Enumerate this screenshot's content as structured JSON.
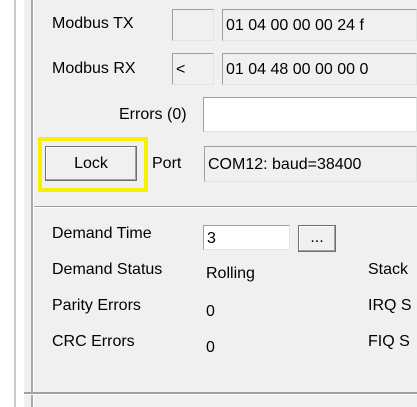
{
  "modbus_tx": {
    "label": "Modbus TX",
    "indicator": "",
    "value": "01 04 00 00 00 24 f"
  },
  "modbus_rx": {
    "label": "Modbus RX",
    "indicator": "<",
    "value": "01 04 48 00 00 00 0"
  },
  "errors": {
    "label": "Errors (0)",
    "value": ""
  },
  "lock_button": {
    "label": "Lock"
  },
  "port": {
    "label": "Port",
    "value": "COM12: baud=38400"
  },
  "demand_time": {
    "label": "Demand Time",
    "value": "3",
    "browse_label": "..."
  },
  "demand_status": {
    "label": "Demand Status",
    "value": "Rolling",
    "side_label": "Stack"
  },
  "parity_errors": {
    "label": "Parity Errors",
    "value": "0",
    "side_label": "IRQ S"
  },
  "crc_errors": {
    "label": "CRC Errors",
    "value": "0",
    "side_label": "FIQ S"
  },
  "colors": {
    "highlight": "#f7f100",
    "panel": "#f0f0f0"
  }
}
